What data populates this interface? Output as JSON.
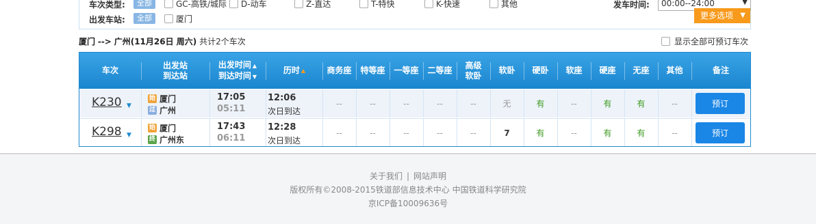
{
  "filter": {
    "train_type_label": "车次类型:",
    "all_label": "全部",
    "train_types": [
      "GC-高铁/城际",
      "D-动车",
      "Z-直达",
      "T-特快",
      "K-快速",
      "其他"
    ],
    "from_station_label": "出发车站:",
    "from_stations": [
      "厦门"
    ],
    "depart_time_label": "发车时间:",
    "depart_time_value": "00:00--24:00",
    "more_options": "更多选项"
  },
  "route": {
    "from": "厦门",
    "arrow": "-->",
    "to": "广州",
    "date": "(11月26日  周六)",
    "count": "共计2个车次",
    "show_all_label": "显示全部可预订车次"
  },
  "table": {
    "headers": {
      "train": "车次",
      "station_a": "出发站",
      "station_b": "到达站",
      "time_a": "出发时间",
      "time_b": "到达时间",
      "duration": "历时",
      "business": "商务座",
      "special": "特等座",
      "first": "一等座",
      "second": "二等座",
      "adv_a": "高级",
      "adv_b": "软卧",
      "soft_sleeper": "软卧",
      "hard_sleeper": "硬卧",
      "soft_seat": "软座",
      "hard_seat": "硬座",
      "no_seat": "无座",
      "other": "其他",
      "remark": "备注"
    },
    "rows": [
      {
        "train_no": "K230",
        "from_badge": "始",
        "from_station": "厦门",
        "to_badge": "过",
        "to_station": "广州",
        "depart": "17:05",
        "arrive": "05:11",
        "duration": "12:06",
        "arrive_note": "次日到达",
        "business": "--",
        "special": "--",
        "first": "--",
        "second": "--",
        "adv_soft": "--",
        "soft_sleeper": "无",
        "hard_sleeper": "有",
        "soft_seat": "--",
        "hard_seat": "有",
        "no_seat": "有",
        "other": "--",
        "book": "预订"
      },
      {
        "train_no": "K298",
        "from_badge": "始",
        "from_station": "厦门",
        "to_badge": "终",
        "to_station": "广州东",
        "depart": "17:43",
        "arrive": "06:11",
        "duration": "12:28",
        "arrive_note": "次日到达",
        "business": "--",
        "special": "--",
        "first": "--",
        "second": "--",
        "adv_soft": "--",
        "soft_sleeper": "7",
        "hard_sleeper": "有",
        "soft_seat": "--",
        "hard_seat": "有",
        "no_seat": "有",
        "other": "--",
        "book": "预订"
      }
    ]
  },
  "footer": {
    "about": "关于我们",
    "separator": "|",
    "statement": "网站声明",
    "copyright": "版权所有©2008-2015铁道部信息技术中心   中国铁道科学研究院",
    "icp": "京ICP备10009636号"
  },
  "colors": {
    "header_blue": "#1a86cf",
    "accent_orange": "#f89a1c",
    "available_green": "#3b9a1e",
    "book_button": "#1a86e6"
  }
}
